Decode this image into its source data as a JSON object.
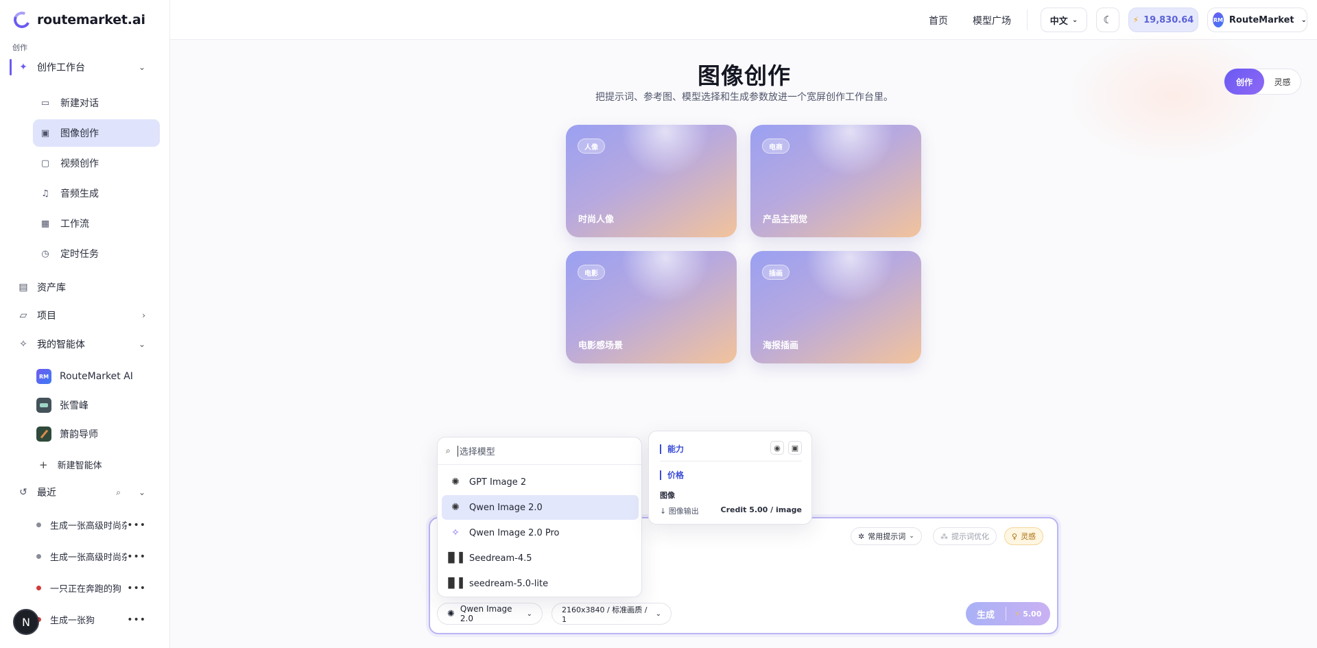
{
  "brand": {
    "name": "routemarket.ai"
  },
  "sidebar": {
    "section_label": "创作",
    "workbench": {
      "label": "创作工作台"
    },
    "sub_items": [
      {
        "label": "新建对话",
        "icon": "chat-icon"
      },
      {
        "label": "图像创作",
        "icon": "image-icon"
      },
      {
        "label": "视频创作",
        "icon": "video-icon"
      },
      {
        "label": "音频生成",
        "icon": "music-icon"
      },
      {
        "label": "工作流",
        "icon": "grid-icon"
      },
      {
        "label": "定时任务",
        "icon": "timer-icon"
      }
    ],
    "assets": {
      "label": "资产库"
    },
    "projects": {
      "label": "项目"
    },
    "agents": {
      "label": "我的智能体"
    },
    "agent_items": [
      {
        "label": "RouteMarket AI",
        "badge": "RM"
      },
      {
        "label": "张雪峰"
      },
      {
        "label": "箫韵导师"
      }
    ],
    "new_agent": {
      "label": "新建智能体"
    },
    "recent": {
      "label": "最近"
    },
    "recent_items": [
      {
        "label": "生成一张高级时尚杂志...",
        "dot_color": "#8a8d98"
      },
      {
        "label": "生成一张高级时尚杂志...",
        "dot_color": "#8a8d98"
      },
      {
        "label": "一只正在奔跑的狗",
        "dot_color": "#d23a3a"
      },
      {
        "label": "生成一张狗",
        "dot_color": "#d23a3a"
      }
    ],
    "fab": "N"
  },
  "topbar": {
    "home": "首页",
    "models": "模型广场",
    "lang": "中文",
    "credits": "19,830.64",
    "user": {
      "initials": "RM",
      "name": "RouteMarket"
    }
  },
  "main": {
    "title": "图像创作",
    "subtitle": "把提示词、参考图、模型选择和生成参数放进一个宽屏创作工作台里。",
    "mode": {
      "active": "创作",
      "other": "灵感"
    },
    "cards": [
      {
        "tag": "人像",
        "caption": "时尚人像"
      },
      {
        "tag": "电商",
        "caption": "产品主视觉"
      },
      {
        "tag": "电影",
        "caption": "电影感场景"
      },
      {
        "tag": "插画",
        "caption": "海报插画"
      }
    ]
  },
  "composer": {
    "prompts_chip": "常用提示词",
    "optimize_chip": "提示词优化",
    "inspire_chip": "灵感",
    "model_select": "Qwen Image 2.0",
    "params_select": "2160x3840 / 标准画质 / 1",
    "generate": "生成",
    "cost": "5.00"
  },
  "model_dropdown": {
    "placeholder": "选择模型",
    "items": [
      {
        "label": "GPT Image 2",
        "icon": "openai-icon"
      },
      {
        "label": "Qwen Image 2.0",
        "icon": "openai-icon",
        "highlighted": true
      },
      {
        "label": "Qwen Image 2.0 Pro",
        "icon": "qwen-icon"
      },
      {
        "label": "Seedream-4.5",
        "icon": "bars-icon"
      },
      {
        "label": "seedream-5.0-lite",
        "icon": "bars-icon"
      }
    ]
  },
  "capability_panel": {
    "ability": "能力",
    "price": "价格",
    "category": "图像",
    "output_label": "↓ 图像输出",
    "output_price": "Credit 5.00 / image"
  },
  "colors": {
    "accent": "#6b5cf0",
    "selected_bg": "#dfe3fb",
    "credit_text": "#5b62d8"
  }
}
